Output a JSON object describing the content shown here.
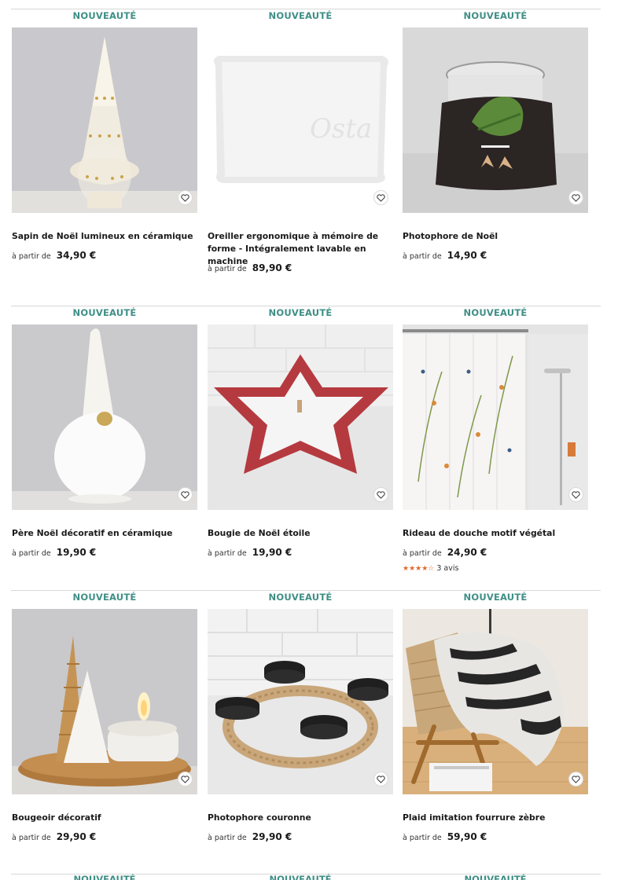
{
  "badge_label": "NOUVEAUTÉ",
  "price_prefix": "à partir de",
  "accent_color": "#3f8f86",
  "rating_color": "#e0682a",
  "products": [
    {
      "name": "Sapin de Noël lumineux en céramique",
      "price": "34,90 €"
    },
    {
      "name": "Oreiller ergonomique à mémoire de forme - Intégralement lavable en machine",
      "price": "89,90 €"
    },
    {
      "name": "Photophore de Noël",
      "price": "14,90 €"
    },
    {
      "name": "Père Noël décoratif en céramique",
      "price": "19,90 €"
    },
    {
      "name": "Bougie de Noël étoile",
      "price": "19,90 €"
    },
    {
      "name": "Rideau de douche motif végétal",
      "price": "24,90 €",
      "rating": 4,
      "reviews": "3 avis"
    },
    {
      "name": "Bougeoir décoratif",
      "price": "29,90 €"
    },
    {
      "name": "Photophore couronne",
      "price": "29,90 €"
    },
    {
      "name": "Plaid imitation fourrure zèbre",
      "price": "59,90 €"
    }
  ],
  "icons": {
    "favorite": "heart-outline-icon",
    "star": "star-icon"
  }
}
